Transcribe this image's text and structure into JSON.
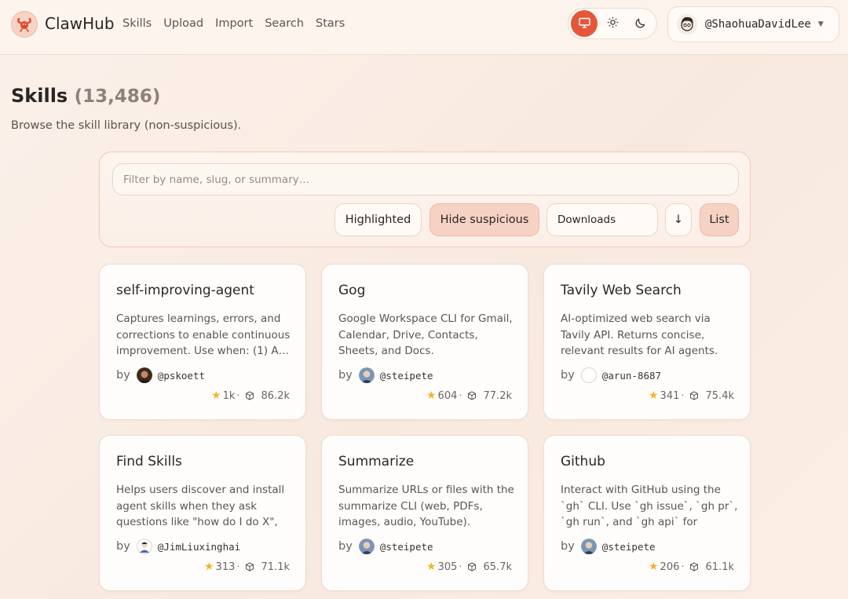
{
  "app": {
    "brand": "ClawHub"
  },
  "nav": {
    "items": [
      "Skills",
      "Upload",
      "Import",
      "Search",
      "Stars"
    ]
  },
  "theme": {
    "options": [
      "system-icon",
      "sun-icon",
      "moon-icon"
    ],
    "active": "system"
  },
  "user": {
    "handle": "@ShaohuaDavidLee"
  },
  "page": {
    "title": "Skills",
    "count": "(13,486)",
    "subtitle": "Browse the skill library (non-suspicious)."
  },
  "filters": {
    "search_placeholder": "Filter by name, slug, or summary…",
    "highlighted_label": "Highlighted",
    "hide_suspicious_label": "Hide suspicious",
    "sort_value": "Downloads",
    "sort_direction": "↓",
    "view_label": "List"
  },
  "skills": [
    {
      "name": "self-improving-agent",
      "summary": "Captures learnings, errors, and corrections to enable continuous improvement. Use when: (1) A…",
      "by": "by",
      "author": "@pskoett",
      "stars": "1k",
      "downloads": "86.2k"
    },
    {
      "name": "Gog",
      "summary": "Google Workspace CLI for Gmail, Calendar, Drive, Contacts, Sheets, and Docs.",
      "by": "by",
      "author": "@steipete",
      "stars": "604",
      "downloads": "77.2k"
    },
    {
      "name": "Tavily Web Search",
      "summary": "AI-optimized web search via Tavily API. Returns concise, relevant results for AI agents.",
      "by": "by",
      "author": "@arun-8687",
      "stars": "341",
      "downloads": "75.4k"
    },
    {
      "name": "Find Skills",
      "summary": "Helps users discover and install agent skills when they ask questions like \"how do I do X\", \"fin…",
      "by": "by",
      "author": "@JimLiuxinghai",
      "stars": "313",
      "downloads": "71.1k"
    },
    {
      "name": "Summarize",
      "summary": "Summarize URLs or files with the summarize CLI (web, PDFs, images, audio, YouTube).",
      "by": "by",
      "author": "@steipete",
      "stars": "305",
      "downloads": "65.7k"
    },
    {
      "name": "Github",
      "summary": "Interact with GitHub using the `gh` CLI. Use `gh issue`, `gh pr`, `gh run`, and `gh api` for issues,…",
      "by": "by",
      "author": "@steipete",
      "stars": "206",
      "downloads": "61.1k"
    }
  ],
  "colors": {
    "accent": "#e5573a",
    "accent_soft": "#f6d2c4",
    "star": "#f2b32c"
  }
}
